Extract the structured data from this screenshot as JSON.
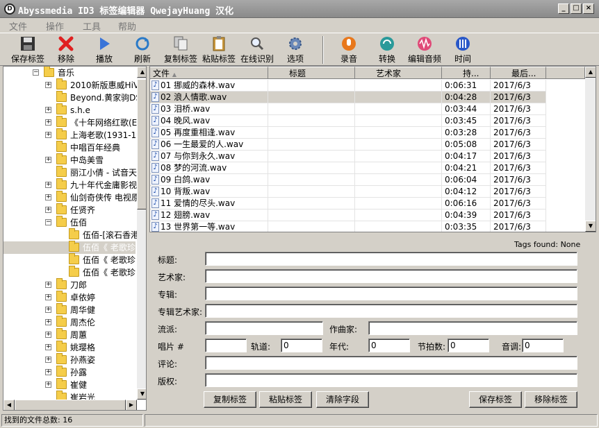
{
  "window": {
    "title": "Abyssmedia ID3 标签编辑器 QwejayHuang 汉化"
  },
  "menu": [
    "文件",
    "操作",
    "工具",
    "帮助"
  ],
  "toolbar": {
    "save_tags": "保存标签",
    "remove": "移除",
    "play": "播放",
    "refresh": "刷新",
    "copy_tags": "复制标签",
    "paste_tags": "粘贴标签",
    "online_identify": "在线识别",
    "options": "选项",
    "record": "录音",
    "convert": "转换",
    "edit_audio": "编辑音频",
    "time": "时间"
  },
  "tree": {
    "root": "音乐",
    "items": [
      "2010新版惠威HiVi",
      "Beyond.黄家驹DSD",
      "s.h.e",
      "《十年网络红歌(E",
      "上海老歌(1931-19",
      "中唱百年经典",
      "中岛美雪",
      "丽江小倩 - 试音天",
      "九十年代金庸影视",
      "仙剑奇侠传 电视原",
      "任贤齐",
      "伍佰",
      "伍佰-[滚石香港",
      "伍佰《 老歌珍",
      "伍佰《 老歌珍",
      "伍佰《 老歌珍",
      "刀郎",
      "卓依婷",
      "周华健",
      "周杰伦",
      "周蕙",
      "姚璎格",
      "孙燕姿",
      "孙露",
      "崔健",
      "崔岩光"
    ]
  },
  "filelist": {
    "columns": [
      "文件",
      "标题",
      "艺术家",
      "持...",
      "最后..."
    ],
    "rows": [
      {
        "file": "01 挪威的森林.wav",
        "duration": "0:06:31",
        "date": "2017/6/3"
      },
      {
        "file": "02 浪人情歌.wav",
        "duration": "0:04:28",
        "date": "2017/6/3"
      },
      {
        "file": "03 泪桥.wav",
        "duration": "0:03:44",
        "date": "2017/6/3"
      },
      {
        "file": "04 晚风.wav",
        "duration": "0:03:45",
        "date": "2017/6/3"
      },
      {
        "file": "05 再度重相逢.wav",
        "duration": "0:03:28",
        "date": "2017/6/3"
      },
      {
        "file": "06 一生最爱的人.wav",
        "duration": "0:05:08",
        "date": "2017/6/3"
      },
      {
        "file": "07 与你到永久.wav",
        "duration": "0:04:17",
        "date": "2017/6/3"
      },
      {
        "file": "08 梦的河流.wav",
        "duration": "0:04:21",
        "date": "2017/6/3"
      },
      {
        "file": "09 白鸽.wav",
        "duration": "0:06:04",
        "date": "2017/6/3"
      },
      {
        "file": "10 背叛.wav",
        "duration": "0:04:12",
        "date": "2017/6/3"
      },
      {
        "file": "11 爱情的尽头.wav",
        "duration": "0:06:16",
        "date": "2017/6/3"
      },
      {
        "file": "12 翅膀.wav",
        "duration": "0:04:39",
        "date": "2017/6/3"
      },
      {
        "file": "13 世界第一等.wav",
        "duration": "0:03:35",
        "date": "2017/6/3"
      }
    ]
  },
  "tags": {
    "found": "Tags found: None",
    "title_label": "标题:",
    "artist_label": "艺术家:",
    "album_label": "专辑:",
    "album_artist_label": "专辑艺术家:",
    "genre_label": "流派:",
    "composer_label": "作曲家:",
    "disc_label": "唱片 #",
    "track_label": "轨道:",
    "track_value": "0",
    "year_label": "年代:",
    "year_value": "0",
    "bpm_label": "节拍数:",
    "bpm_value": "0",
    "key_label": "音调:",
    "key_value": "0",
    "comment_label": "评论:",
    "copyright_label": "版权:",
    "copy_button": "复制标签",
    "paste_button": "粘贴标签",
    "clear_button": "清除字段",
    "save_button": "保存标签",
    "remove_button": "移除标签"
  },
  "status": {
    "text": "找到的文件总数:  16"
  }
}
